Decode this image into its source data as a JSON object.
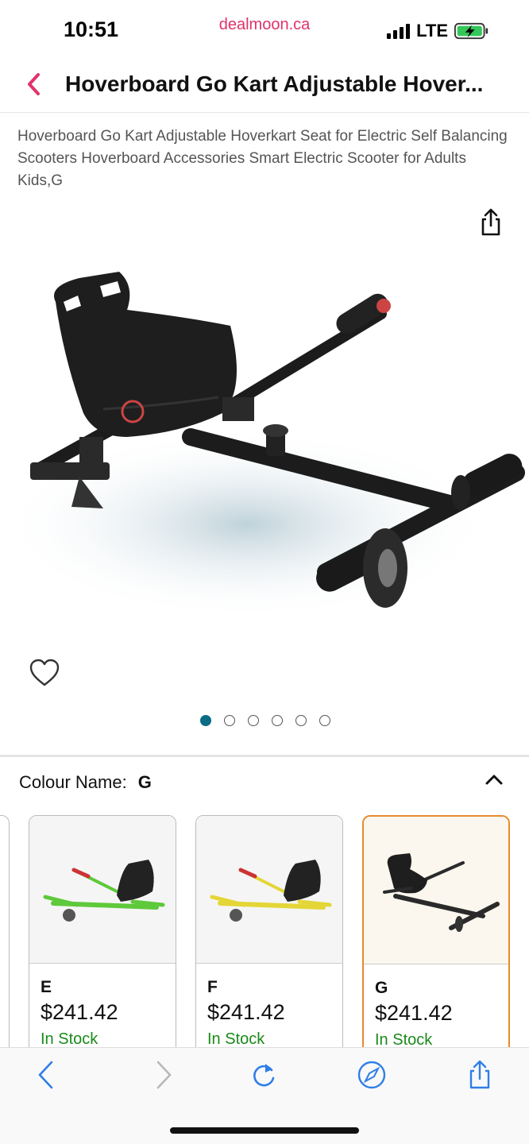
{
  "status_bar": {
    "time": "10:51",
    "site": "dealmoon.ca",
    "network": "LTE"
  },
  "header": {
    "title": "Hoverboard Go Kart Adjustable Hover..."
  },
  "product": {
    "description": "Hoverboard Go Kart Adjustable Hoverkart Seat for Electric Self Balancing Scooters Hoverboard Accessories Smart Electric Scooter for Adults Kids,G",
    "image_count": 6,
    "active_image_index": 1
  },
  "variant": {
    "label": "Colour Name:",
    "selected": "G",
    "options": [
      {
        "name": "E",
        "price": "$241.42",
        "stock": "In Stock",
        "color": "#5ec93a"
      },
      {
        "name": "F",
        "price": "$241.42",
        "stock": "In Stock",
        "color": "#e3d636"
      },
      {
        "name": "G",
        "price": "$241.42",
        "stock": "In Stock",
        "color": "#2a2a2a"
      }
    ]
  },
  "colors": {
    "accent": "#e0336a",
    "selected_border": "#e88a2c",
    "in_stock": "#1a8a1a",
    "ios_blue": "#2f7ee8",
    "dot_active": "#0b6c86"
  },
  "icons": [
    "back-chevron-icon",
    "share-icon",
    "heart-icon",
    "chevron-up-icon",
    "browser-back-icon",
    "browser-forward-icon",
    "reload-icon",
    "compass-icon",
    "share-icon"
  ]
}
